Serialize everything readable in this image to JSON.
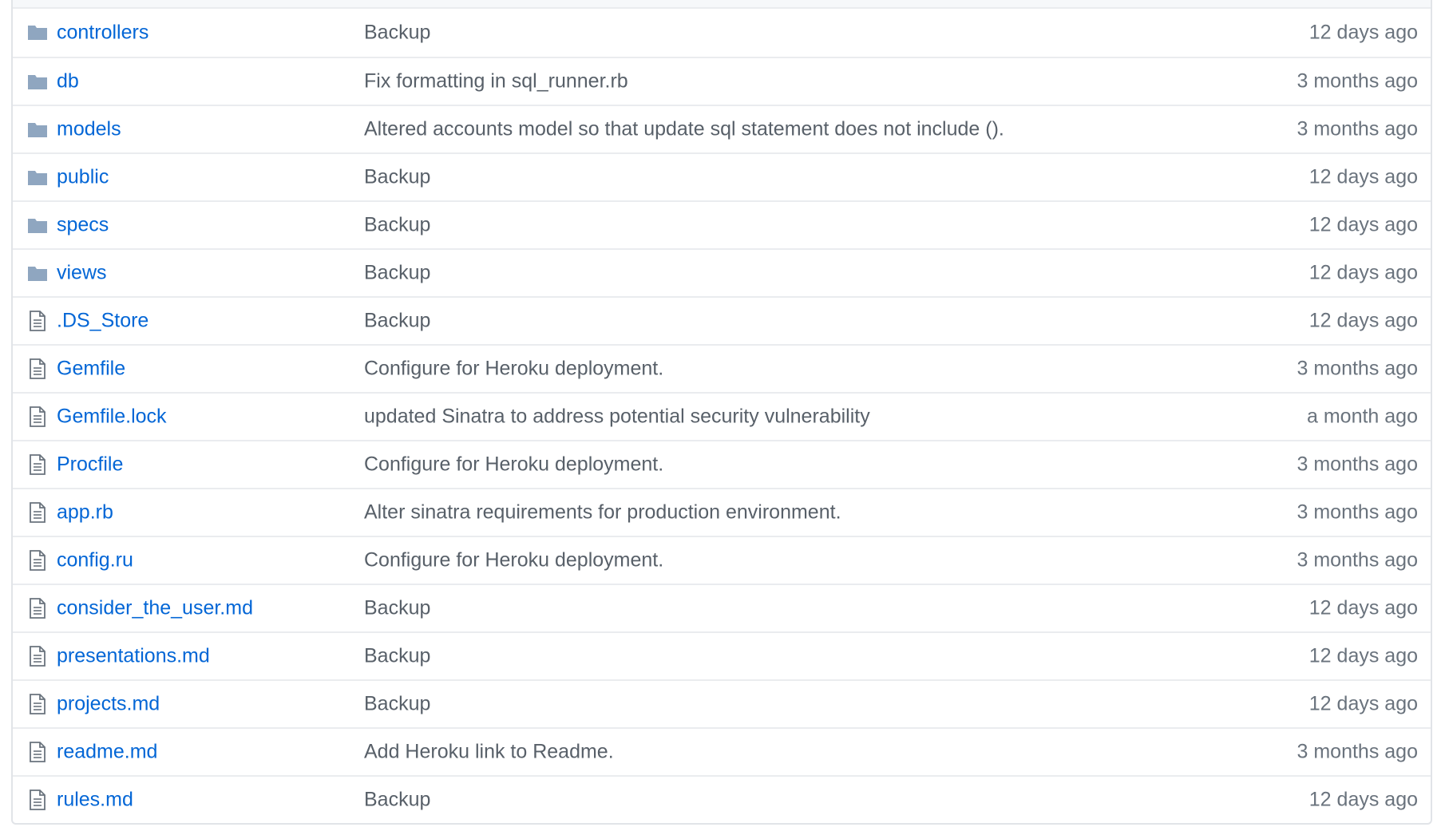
{
  "colors": {
    "link": "#0366d6",
    "message": "#586069",
    "age": "#6a737d",
    "folder_icon": "#79b8ff",
    "file_icon": "#6a737d",
    "border": "#e1e4e8"
  },
  "files": [
    {
      "name": "controllers",
      "icon": "folder-icon",
      "message": "Backup",
      "age": "12 days ago"
    },
    {
      "name": "db",
      "icon": "folder-icon",
      "message": "Fix formatting in sql_runner.rb",
      "age": "3 months ago"
    },
    {
      "name": "models",
      "icon": "folder-icon",
      "message": "Altered accounts model so that update sql statement does not include ().",
      "age": "3 months ago"
    },
    {
      "name": "public",
      "icon": "folder-icon",
      "message": "Backup",
      "age": "12 days ago"
    },
    {
      "name": "specs",
      "icon": "folder-icon",
      "message": "Backup",
      "age": "12 days ago"
    },
    {
      "name": "views",
      "icon": "folder-icon",
      "message": "Backup",
      "age": "12 days ago"
    },
    {
      "name": ".DS_Store",
      "icon": "file-icon",
      "message": "Backup",
      "age": "12 days ago"
    },
    {
      "name": "Gemfile",
      "icon": "file-icon",
      "message": "Configure for Heroku deployment.",
      "age": "3 months ago"
    },
    {
      "name": "Gemfile.lock",
      "icon": "file-icon",
      "message": "updated Sinatra to address potential security vulnerability",
      "age": "a month ago"
    },
    {
      "name": "Procfile",
      "icon": "file-icon",
      "message": "Configure for Heroku deployment.",
      "age": "3 months ago"
    },
    {
      "name": "app.rb",
      "icon": "file-icon",
      "message": "Alter sinatra requirements for production environment.",
      "age": "3 months ago"
    },
    {
      "name": "config.ru",
      "icon": "file-icon",
      "message": "Configure for Heroku deployment.",
      "age": "3 months ago"
    },
    {
      "name": "consider_the_user.md",
      "icon": "file-icon",
      "message": "Backup",
      "age": "12 days ago"
    },
    {
      "name": "presentations.md",
      "icon": "file-icon",
      "message": "Backup",
      "age": "12 days ago"
    },
    {
      "name": "projects.md",
      "icon": "file-icon",
      "message": "Backup",
      "age": "12 days ago"
    },
    {
      "name": "readme.md",
      "icon": "file-icon",
      "message": "Add Heroku link to Readme.",
      "age": "3 months ago"
    },
    {
      "name": "rules.md",
      "icon": "file-icon",
      "message": "Backup",
      "age": "12 days ago"
    }
  ]
}
